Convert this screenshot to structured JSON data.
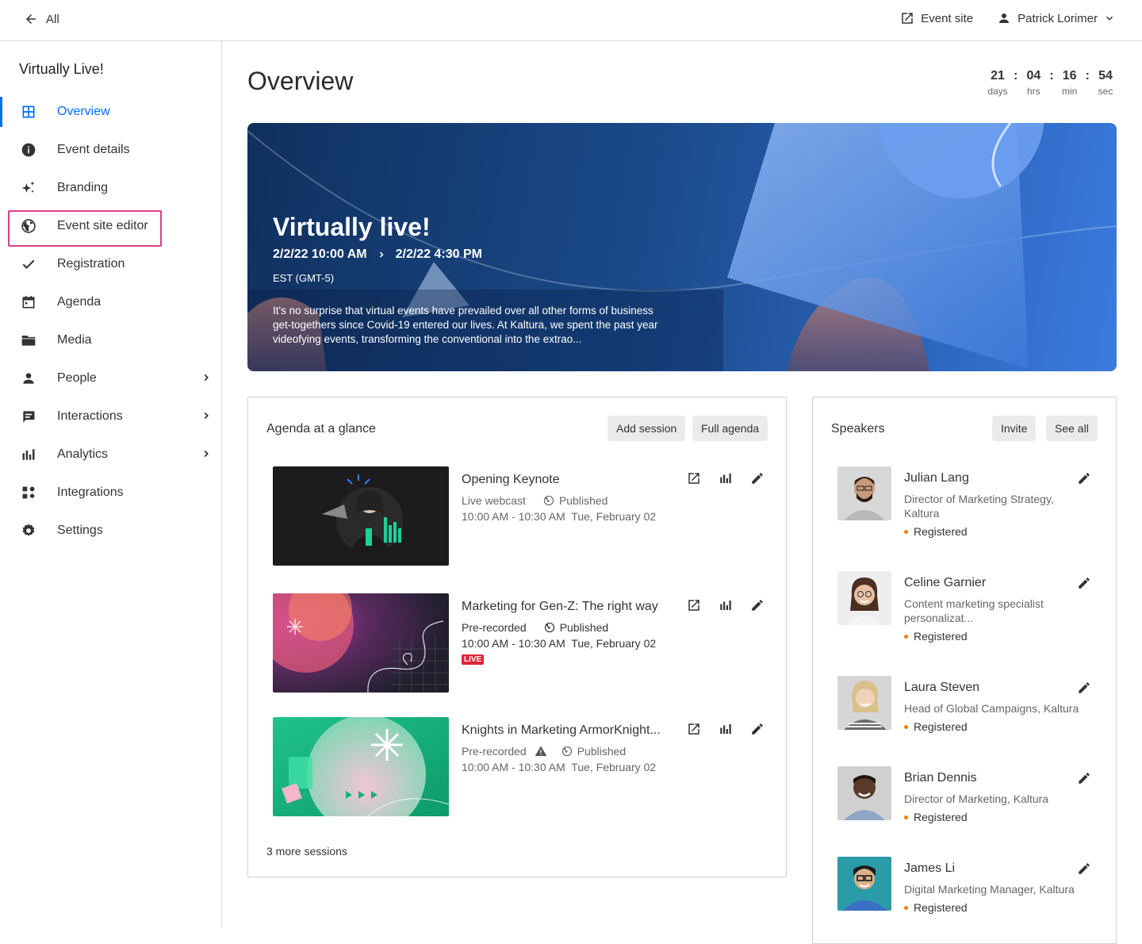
{
  "topbar": {
    "back_label": "All",
    "event_site_label": "Event site",
    "user_name": "Patrick Lorimer"
  },
  "sidebar": {
    "title": "Virtually Live!",
    "items": [
      {
        "label": "Overview",
        "icon": "grid-icon",
        "active": true
      },
      {
        "label": "Event details",
        "icon": "info-icon"
      },
      {
        "label": "Branding",
        "icon": "sparkle-icon"
      },
      {
        "label": "Event site editor",
        "icon": "globe-icon",
        "highlighted": true
      },
      {
        "label": "Registration",
        "icon": "check-icon"
      },
      {
        "label": "Agenda",
        "icon": "calendar-icon"
      },
      {
        "label": "Media",
        "icon": "folder-icon"
      },
      {
        "label": "People",
        "icon": "person-icon",
        "expandable": true
      },
      {
        "label": "Interactions",
        "icon": "chat-icon",
        "expandable": true
      },
      {
        "label": "Analytics",
        "icon": "bar-chart-icon",
        "expandable": true
      },
      {
        "label": "Integrations",
        "icon": "apps-icon"
      },
      {
        "label": "Settings",
        "icon": "gear-icon"
      }
    ]
  },
  "main": {
    "title": "Overview",
    "countdown": {
      "days": "21",
      "days_label": "days",
      "hrs": "04",
      "hrs_label": "hrs",
      "min": "16",
      "min_label": "min",
      "sec": "54",
      "sec_label": "sec",
      "separator": ":"
    },
    "hero": {
      "title": "Virtually live!",
      "start": "2/2/22 10:00 AM",
      "end": "2/2/22 4:30 PM",
      "timezone": "EST (GMT-5)",
      "description": "It's no surprise that virtual events have prevailed over all other forms of business get-togethers since Covid-19 entered our lives. At Kaltura, we spent the past year videofying events, transforming the conventional into the extrao..."
    },
    "agenda": {
      "title": "Agenda at a glance",
      "add_session": "Add session",
      "full_agenda": "Full agenda",
      "sessions": [
        {
          "title": "Opening Keynote",
          "type": "Live webcast",
          "status": "Published",
          "time": "10:00 AM - 10:30 AM",
          "date": "Tue, February 02"
        },
        {
          "title": "Marketing for Gen-Z: The right way",
          "type": "Pre-recorded",
          "status": "Published",
          "time": "10:00 AM - 10:30 AM",
          "date": "Tue, February 02",
          "badge": "LIVE"
        },
        {
          "title": "Knights in Marketing ArmorKnight...",
          "type": "Pre-recorded",
          "status": "Published",
          "time": "10:00 AM - 10:30 AM",
          "date": "Tue, February 02"
        }
      ],
      "more": "3 more sessions"
    },
    "speakers": {
      "title": "Speakers",
      "invite": "Invite",
      "see_all": "See all",
      "list": [
        {
          "name": "Julian Lang",
          "role": "Director of Marketing Strategy, Kaltura",
          "status": "Registered"
        },
        {
          "name": "Celine Garnier",
          "role": "Content marketing specialist personalizat...",
          "status": "Registered"
        },
        {
          "name": "Laura Steven",
          "role": "Head of Global Campaigns, Kaltura",
          "status": "Registered"
        },
        {
          "name": "Brian Dennis",
          "role": "Director of Marketing, Kaltura",
          "status": "Registered"
        },
        {
          "name": "James Li",
          "role": "Digital Marketing Manager, Kaltura",
          "status": "Registered"
        }
      ]
    }
  },
  "colors": {
    "accent": "#006EFA",
    "highlight": "#D93F8C",
    "live": "#E12437",
    "status_dot": "#F57C00"
  }
}
